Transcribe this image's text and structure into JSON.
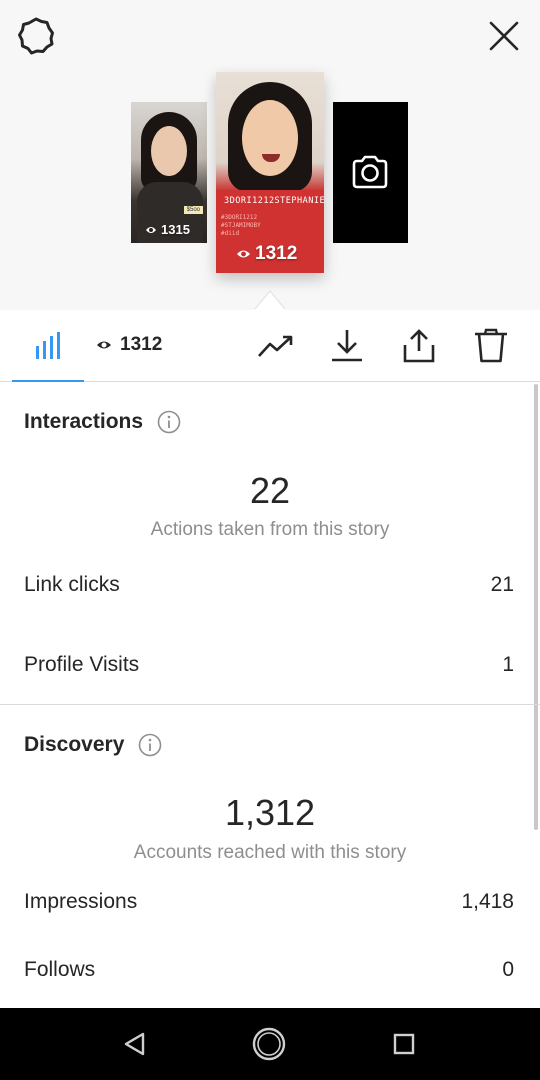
{
  "header": {
    "settings_icon": "settings-gear-icon",
    "close_icon": "close-icon"
  },
  "stories": [
    {
      "views": "1315",
      "tag": "$5oo"
    },
    {
      "views": "1312",
      "caption": "3DORI1212STEPHANIE21",
      "tags": [
        "#3DORI1212",
        "#STJAMIMOBY",
        "#diid"
      ]
    },
    {
      "icon": "camera-icon"
    }
  ],
  "toolbar": {
    "viewer_count": "1312",
    "icons": [
      "insights-bars-icon",
      "eye-icon",
      "trend-icon",
      "download-icon",
      "share-icon",
      "trash-icon"
    ]
  },
  "interactions": {
    "title": "Interactions",
    "total": "22",
    "caption": "Actions taken from this story",
    "rows": [
      {
        "label": "Link clicks",
        "value": "21"
      },
      {
        "label": "Profile Visits",
        "value": "1"
      }
    ]
  },
  "discovery": {
    "title": "Discovery",
    "total": "1,312",
    "caption": "Accounts reached with this story",
    "rows": [
      {
        "label": "Impressions",
        "value": "1,418"
      },
      {
        "label": "Follows",
        "value": "0"
      }
    ]
  },
  "colors": {
    "accent": "#3897f0",
    "story_red": "#c62d2b",
    "muted_text": "#8e8e8e",
    "text": "#262626"
  },
  "navbar": {
    "icons": [
      "back-icon",
      "home-icon",
      "recents-icon"
    ]
  }
}
